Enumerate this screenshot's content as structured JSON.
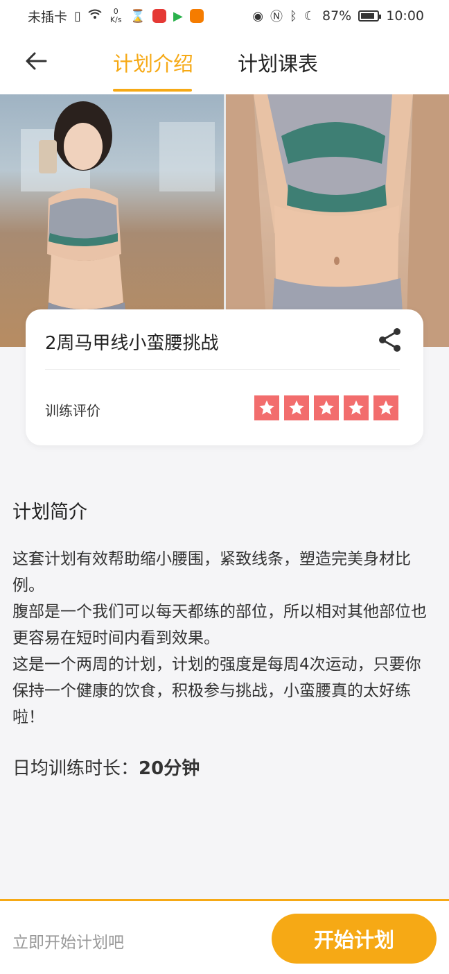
{
  "status_bar": {
    "carrier": "未插卡",
    "net_speed_value": "0",
    "net_speed_unit": "K/s",
    "battery": "87%",
    "time": "10:00",
    "battery_level": 0.87
  },
  "nav": {
    "tab_intro": "计划介绍",
    "tab_schedule": "计划课表"
  },
  "card": {
    "title": "2周马甲线小蛮腰挑战",
    "rating_label": "训练评价",
    "rating": 5,
    "rating_max": 5,
    "star_color": "#f26d6d"
  },
  "intro": {
    "heading": "计划简介",
    "paragraphs": [
      "这套计划有效帮助缩小腰围，紧致线条，塑造完美身材比例。",
      "腹部是一个我们可以每天都练的部位，所以相对其他部位也更容易在短时间内看到效果。",
      "这是一个两周的计划，计划的强度是每周4次运动，只要你保持一个健康的饮食，积极参与挑战，小蛮腰真的太好练啦！"
    ],
    "duration_label": "日均训练时长：",
    "duration_value": "20分钟"
  },
  "bottom": {
    "hint": "立即开始计划吧",
    "start_button": "开始计划"
  },
  "theme": {
    "accent": "#f6a915"
  }
}
